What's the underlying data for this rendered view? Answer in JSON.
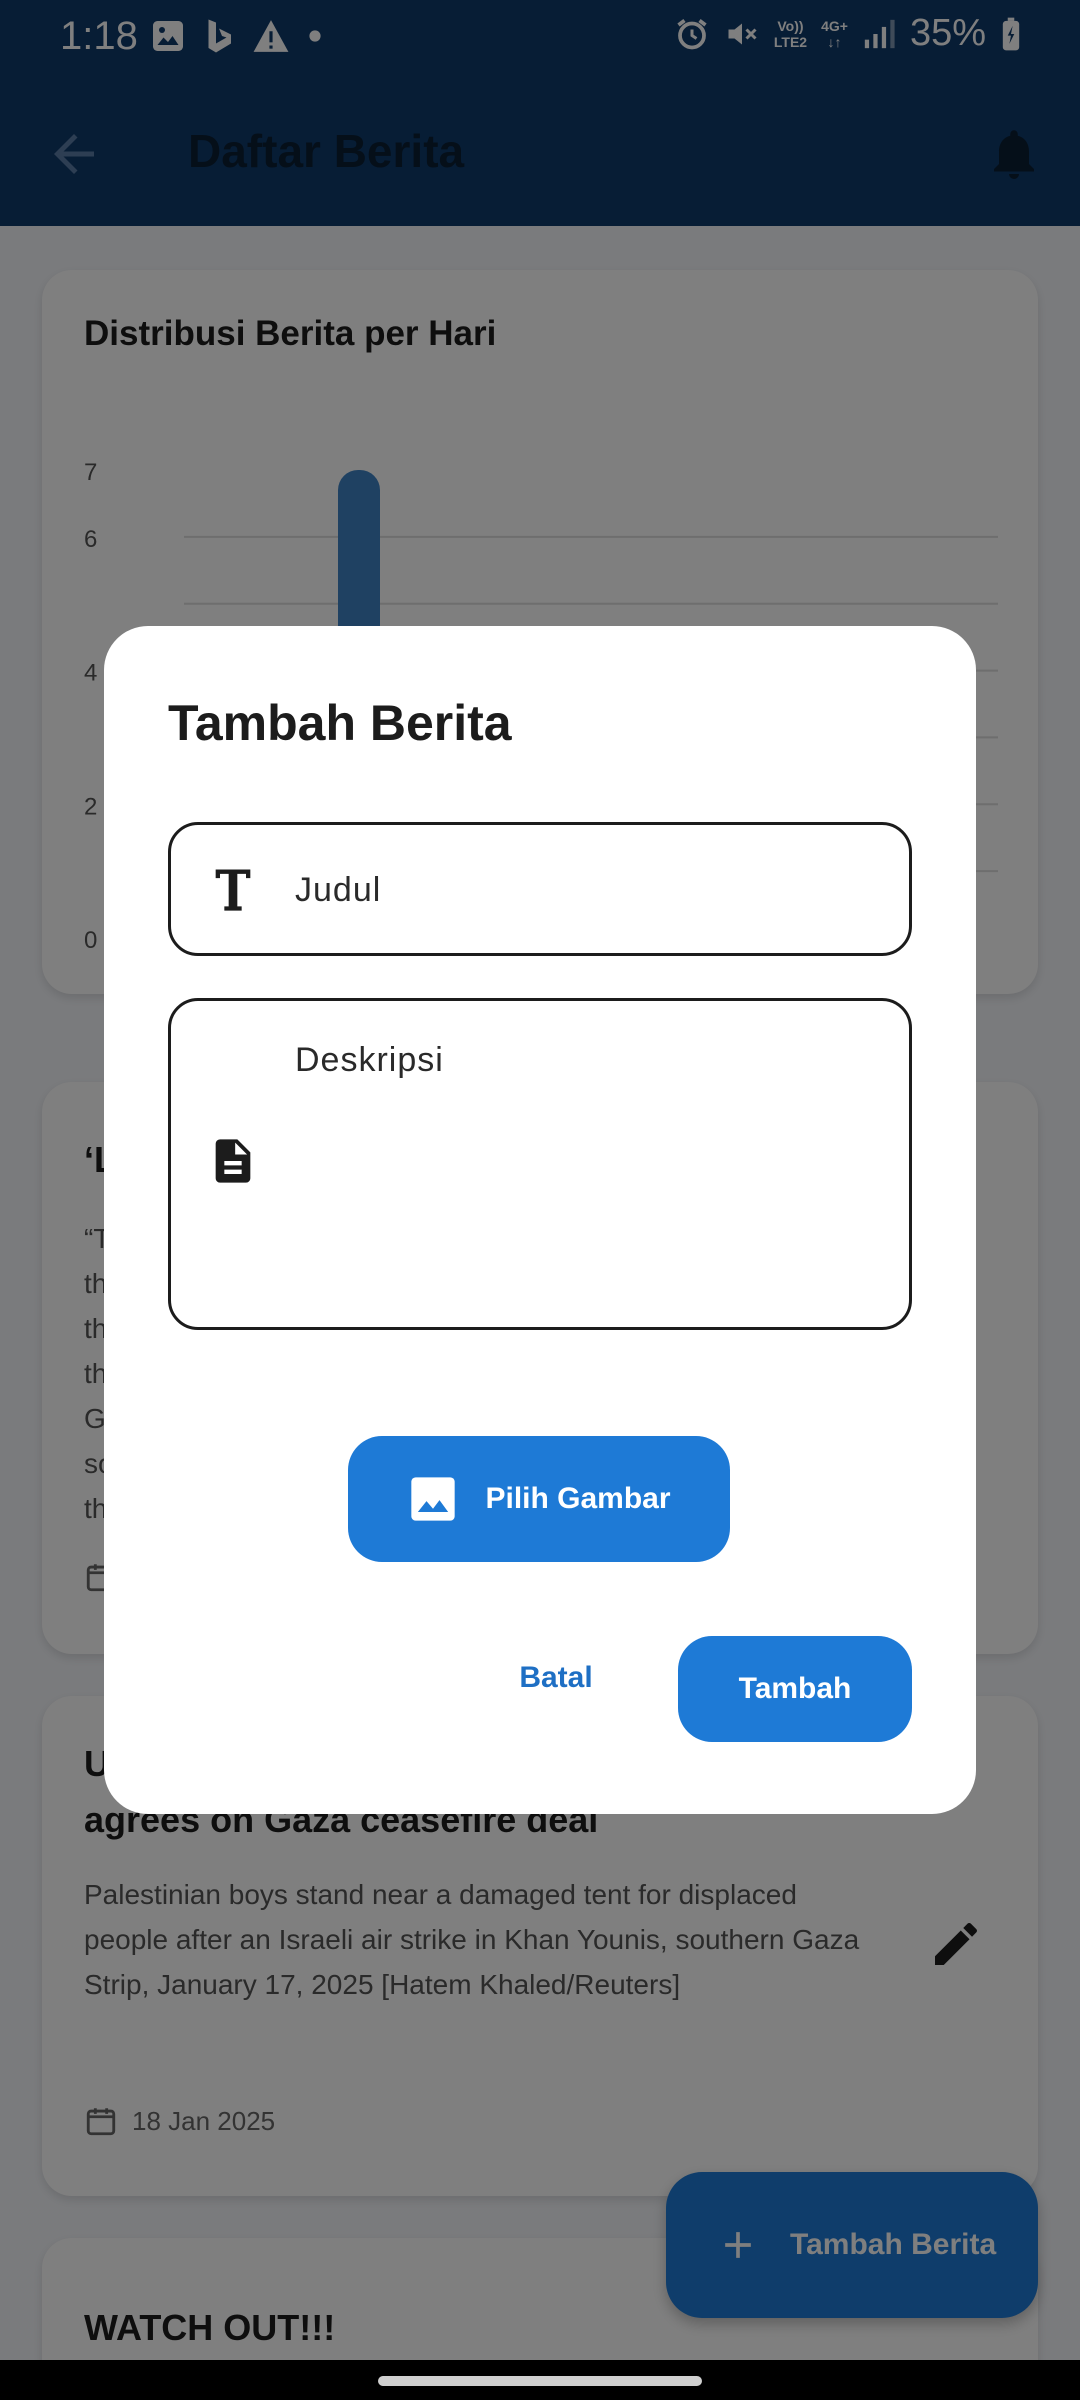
{
  "status_bar": {
    "time": "1:18",
    "network_top": "Vo))",
    "network_bottom": "LTE2",
    "network_type": "4G+",
    "battery": "35%"
  },
  "app_bar": {
    "title": "Daftar Berita",
    "back_icon": "arrow-left",
    "notification_icon": "bell"
  },
  "chart_card": {
    "title": "Distribusi Berita per Hari"
  },
  "chart_data": {
    "type": "bar",
    "title": "Distribusi Berita per Hari",
    "yticks": [
      "7",
      "6",
      "4",
      "2",
      "0"
    ],
    "ylim": [
      0,
      7
    ],
    "values": [
      7
    ],
    "bar_color": "#3f83c4",
    "grid": true
  },
  "news": [
    {
      "title": "‘L",
      "desc_lines": [
        "“T",
        "th",
        "th",
        "th",
        "G",
        "so",
        "th"
      ]
    },
    {
      "title_lines": [
        "U",
        "agrees on Gaza ceasefire deal"
      ],
      "desc": "Palestinian boys stand near a damaged tent for displaced people after an Israeli air strike in Khan Younis, southern Gaza Strip, January 17, 2025 [Hatem Khaled/Reuters]",
      "date": "18 Jan 2025"
    },
    {
      "title": "WATCH OUT!!!"
    }
  ],
  "fab": {
    "label": "Tambah Berita"
  },
  "dialog": {
    "title": "Tambah Berita",
    "title_field": {
      "placeholder": "Judul",
      "value": ""
    },
    "desc_field": {
      "placeholder": "Deskripsi",
      "value": ""
    },
    "pick_image_label": "Pilih Gambar",
    "cancel_label": "Batal",
    "submit_label": "Tambah"
  },
  "colors": {
    "primary": "#1e7ad6",
    "app_bar": "#0e3a6b",
    "scrim": "rgba(0,0,0,0.5)"
  }
}
